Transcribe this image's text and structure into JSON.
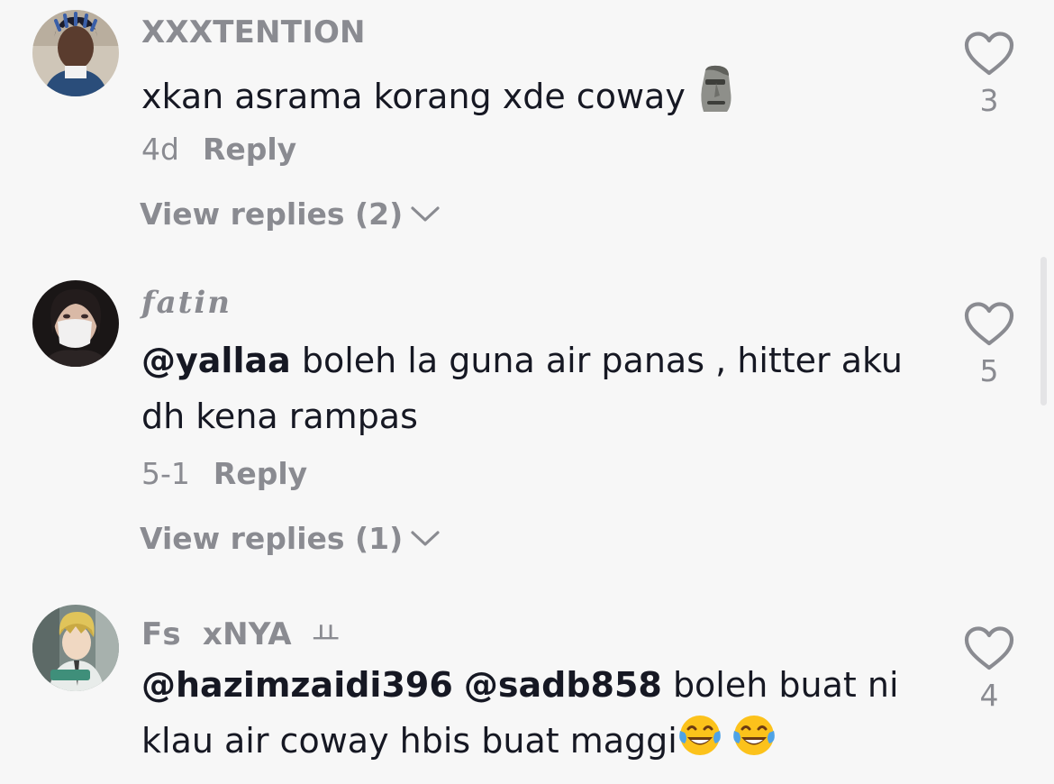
{
  "comments": [
    {
      "username": "XXXTENTION",
      "text": "xkan asrama korang xde coway",
      "emoji": "moai-icon",
      "time": "4d",
      "reply_label": "Reply",
      "view_replies": "View replies (2)",
      "likes": "3"
    },
    {
      "username": "fatin",
      "mention": "@yallaa",
      "text": " boleh la guna air panas , hitter aku dh kena rampas",
      "time": "5-1",
      "reply_label": "Reply",
      "view_replies": "View replies (1)",
      "likes": "5"
    },
    {
      "username": "Fs  xNYA",
      "username_suffix": "ㅛ",
      "mention1": "@hazimzaidi396",
      "mention2": "@sadb858",
      "text": " boleh buat ni klau air coway hbis buat maggi",
      "emoji": "laughing-tears-icon",
      "likes": "4"
    }
  ],
  "colors": {
    "background": "#f7f7f7",
    "text": "#161823",
    "secondary": "#8a8b91"
  }
}
